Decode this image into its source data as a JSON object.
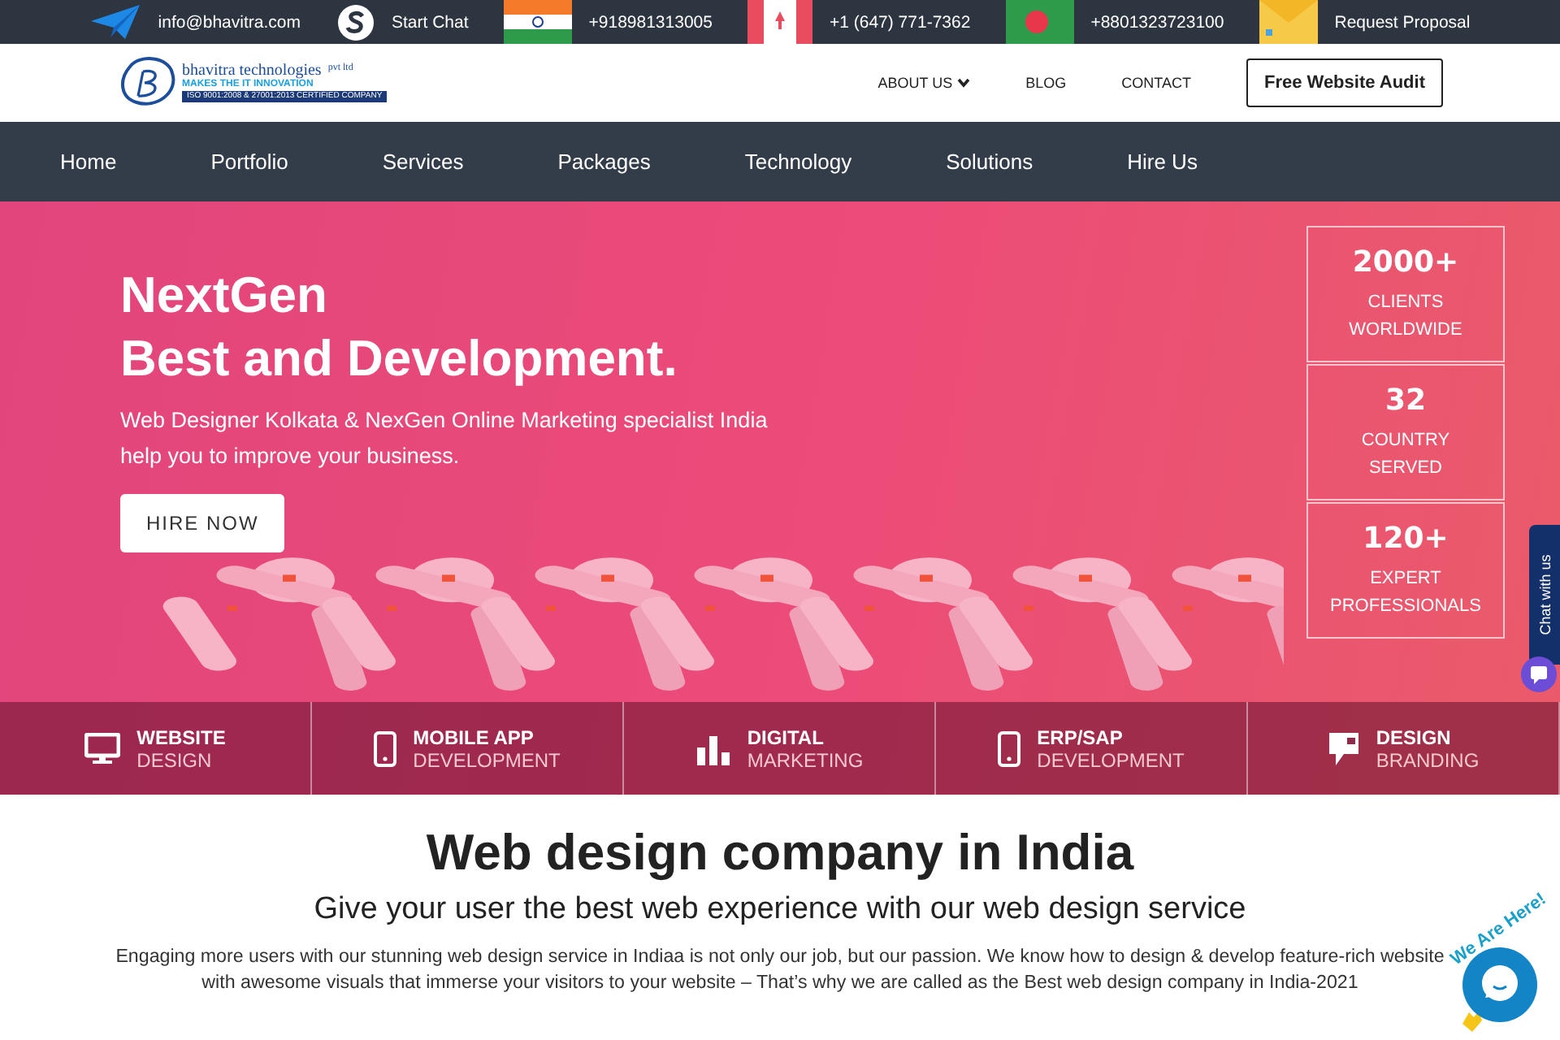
{
  "top_bar": [
    {
      "kind": "mail",
      "text": "info@bhavitra.com"
    },
    {
      "kind": "skype",
      "text": "Start Chat"
    },
    {
      "kind": "india",
      "text": "+918981313005"
    },
    {
      "kind": "canada",
      "text": "+1 (647) 771-7362"
    },
    {
      "kind": "bangladesh",
      "text": "+8801323723100"
    },
    {
      "kind": "envelope",
      "text": "Request Proposal"
    }
  ],
  "logo": {
    "name": "bhavitra technologies",
    "suffix": "pvt ltd",
    "tagline": "MAKES THE IT INNOVATION",
    "certification": "ISO 9001:2008 & 27001:2013 CERTIFIED COMPANY"
  },
  "header_links": [
    {
      "label": "ABOUT US",
      "dropdown": true
    },
    {
      "label": "BLOG",
      "dropdown": false
    },
    {
      "label": "CONTACT",
      "dropdown": false
    }
  ],
  "audit_button": "Free Website Audit",
  "nav": [
    "Home",
    "Portfolio",
    "Services",
    "Packages",
    "Technology",
    "Solutions",
    "Hire Us"
  ],
  "hero": {
    "title_line_1": "NextGen",
    "title_line_2": "Best and Development.",
    "subtitle": "Web Designer Kolkata & NexGen Online Marketing specialist India help you to improve your business.",
    "button": "HIRE NOW"
  },
  "stats": [
    {
      "value": "2000+",
      "label_1": "CLIENTS",
      "label_2": "WORLDWIDE"
    },
    {
      "value": "32",
      "label_1": "COUNTRY",
      "label_2": "SERVED"
    },
    {
      "value": "120+",
      "label_1": "EXPERT",
      "label_2": "PROFESSIONALS"
    }
  ],
  "services": [
    {
      "kind": "monitor",
      "title": "WEBSITE",
      "subtitle": "DESIGN"
    },
    {
      "kind": "phone",
      "title": "MOBILE APP",
      "subtitle": "DEVELOPMENT"
    },
    {
      "kind": "bars",
      "title": "DIGITAL",
      "subtitle": "MARKETING"
    },
    {
      "kind": "phone",
      "title": "ERP/SAP",
      "subtitle": "DEVELOPMENT"
    },
    {
      "kind": "flag",
      "title": "DESIGN",
      "subtitle": "BRANDING"
    }
  ],
  "chat_tab": "Chat with us",
  "chat_badge": "We Are Here!",
  "section": {
    "heading": "Web design company in India",
    "subheading": "Give your user the best web experience with our web design service",
    "paragraph": "Engaging more users with our stunning web design service in Indiaa is not only our job, but our passion. We know how to design & develop feature-rich website with awesome visuals that immerse your visitors to your website – That’s why we are called as the Best web design company in India-2021"
  }
}
